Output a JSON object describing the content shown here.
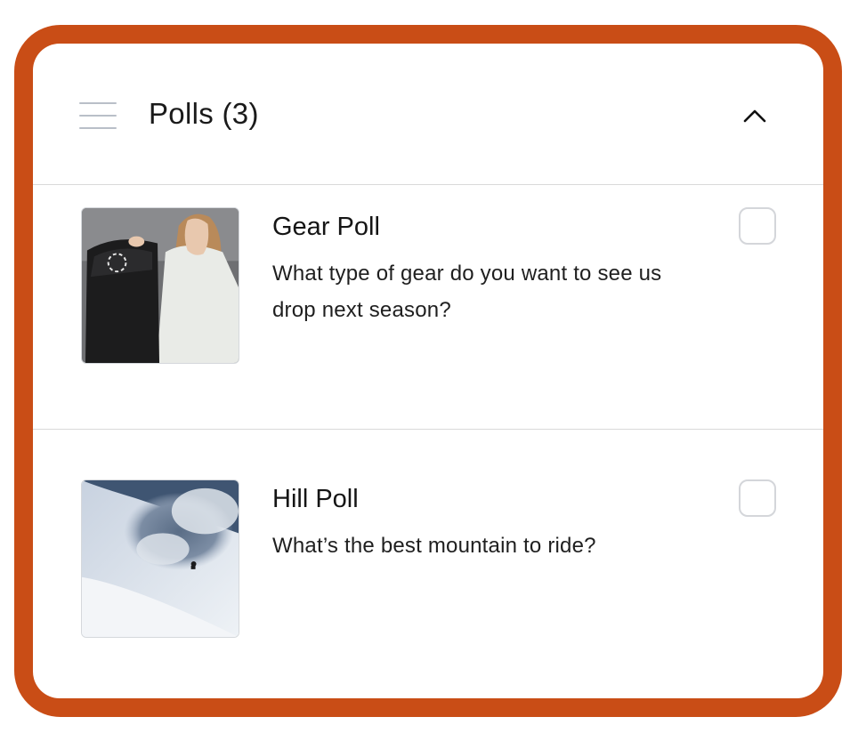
{
  "header": {
    "title": "Polls (3)",
    "menu_icon": "hamburger-menu-icon",
    "collapse_icon": "chevron-up-icon"
  },
  "polls": [
    {
      "title": "Gear Poll",
      "question": "What type of gear do you want to see us drop next season?",
      "image": "woman-with-snowboard-photo",
      "checked": false
    },
    {
      "title": "Hill Poll",
      "question": "What’s the best mountain to ride?",
      "image": "snowboarder-powder-spray-photo",
      "checked": false
    }
  ],
  "colors": {
    "frame": "#c94d16",
    "divider": "#d9d9d9",
    "text": "#1a1a1a"
  }
}
